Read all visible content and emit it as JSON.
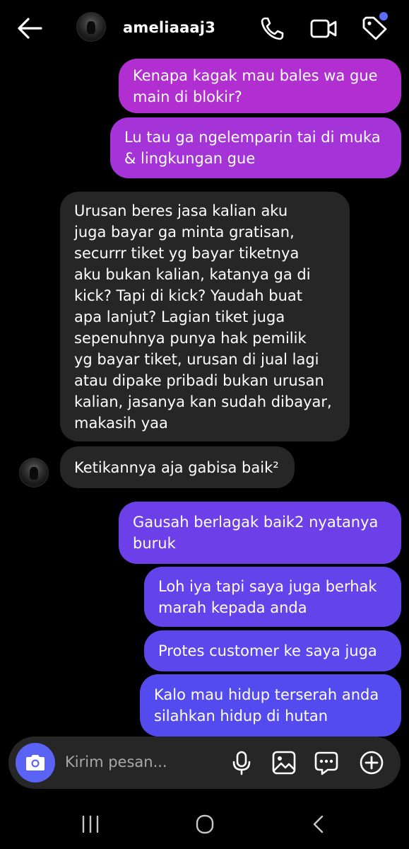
{
  "header": {
    "username": "ameliaaaj3",
    "icons": [
      "back-arrow-icon",
      "phone-icon",
      "video-camera-icon",
      "tag-icon"
    ]
  },
  "messages": [
    {
      "side": "out",
      "text": "Kenapa kagak mau bales wa gue\nmain di blokir?",
      "color": "#b12fd0"
    },
    {
      "side": "out",
      "text": "Lu tau ga ngelemparin tai di muka\n& lingkungan gue",
      "color": "#a433d8"
    },
    {
      "side": "in",
      "text": "Urusan beres jasa kalian aku\njuga bayar ga minta gratisan,\nsecurrr tiket yg bayar tiketnya\naku bukan kalian, katanya ga di\nkick? Tapi di kick? Yaudah buat\napa lanjut? Lagian tiket juga\nsepenuhnya punya hak pemilik\nyg bayar tiket, urusan di jual lagi\natau dipake pribadi bukan urusan\nkalian, jasanya kan sudah dibayar,\nmakasih yaa",
      "color": "#262626"
    },
    {
      "side": "in",
      "text": "Ketikannya aja gabisa baik²",
      "color": "#262626"
    },
    {
      "side": "out",
      "text": "Gausah berlagak baik2 nyatanya\nburuk",
      "color": "#6d3fe9"
    },
    {
      "side": "out",
      "text": "Loh iya tapi saya juga berhak\nmarah kepada anda",
      "color": "#6344ea"
    },
    {
      "side": "out",
      "text": "Protes customer ke saya juga",
      "color": "#5b47ec"
    },
    {
      "side": "out",
      "text": "Kalo mau hidup terserah anda\nsilahkan hidup di hutan",
      "color": "#544bee"
    }
  ],
  "composer": {
    "placeholder": "Kirim pesan...",
    "accent": "#5b63f5",
    "icons": [
      "camera-icon",
      "microphone-icon",
      "gallery-icon",
      "sticker-icon",
      "plus-icon"
    ]
  },
  "navbar": {
    "icons": [
      "recent-apps-icon",
      "home-icon",
      "back-icon"
    ]
  }
}
